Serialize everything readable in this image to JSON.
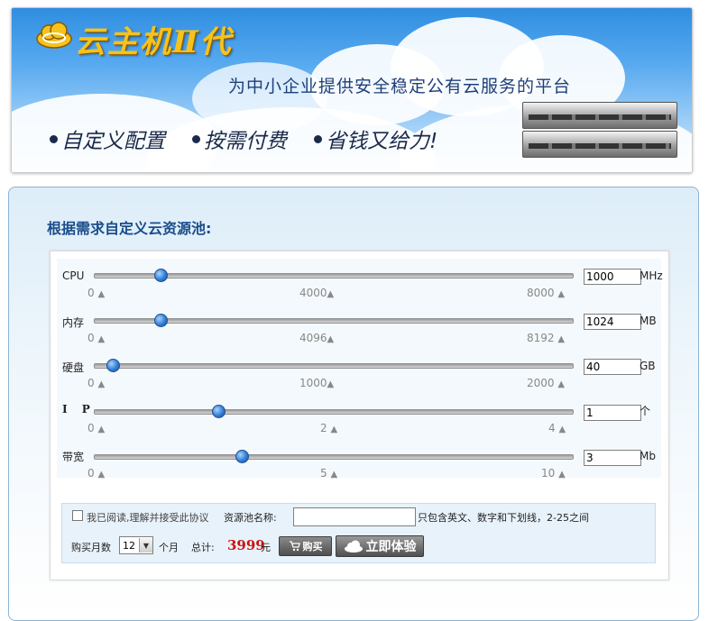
{
  "banner": {
    "title": "云主机Ⅱ代",
    "slogan": "为中小企业提供安全稳定公有云服务的平台",
    "features": [
      "自定义配置",
      "按需付费",
      "省钱又给力!"
    ]
  },
  "config": {
    "heading": "根据需求自定义云资源池:",
    "sliders": [
      {
        "label": "CPU",
        "value": "1000",
        "unit": "MHz",
        "level": 0.14,
        "ticks": [
          "0",
          "4000",
          "8000"
        ]
      },
      {
        "label": "内存",
        "value": "1024",
        "unit": "MB",
        "level": 0.14,
        "ticks": [
          "0",
          "4096",
          "8192"
        ]
      },
      {
        "label": "硬盘",
        "value": "40",
        "unit": "GB",
        "level": 0.04,
        "ticks": [
          "0",
          "1000",
          "2000"
        ]
      },
      {
        "label": "I P",
        "value": "1",
        "unit": "个",
        "level": 0.26,
        "ticks": [
          "0",
          "2",
          "4"
        ]
      },
      {
        "label": "带宽",
        "value": "3",
        "unit": "Mb",
        "level": 0.31,
        "ticks": [
          "0",
          "5",
          "10"
        ]
      }
    ]
  },
  "order": {
    "agree_text": "我已阅读,理解并接受此协议",
    "pool_label": "资源池名称:",
    "pool_value": "",
    "pool_hint": "只包含英文、数字和下划线，2-25之间",
    "months_label": "购买月数",
    "months_value": "12",
    "month_unit": "个月",
    "total_label": "总计:",
    "total_value": "3999",
    "total_unit": "元",
    "buy_label": "购买",
    "try_label": "立即体验"
  },
  "colors": {
    "accent": "#1b4d8a",
    "total": "#d01010",
    "knob": "#2f7fd6"
  }
}
